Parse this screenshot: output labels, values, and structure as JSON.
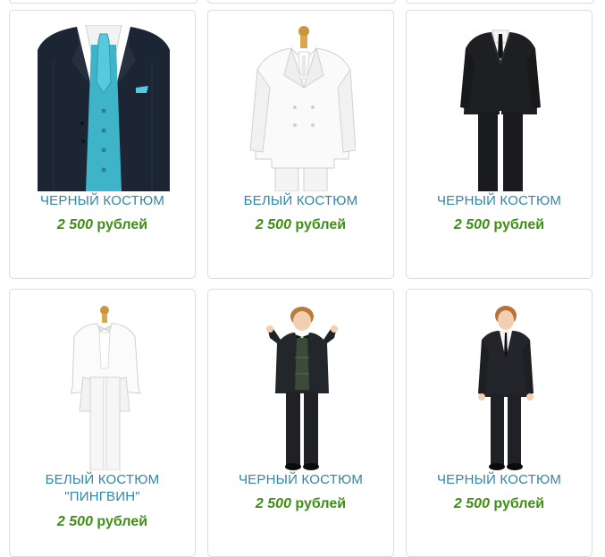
{
  "colors": {
    "title": "#2f86a8",
    "price": "#3f8f17",
    "card_border": "#dcdcdc"
  },
  "products": [
    {
      "title": "ЧЕРНЫЙ КОСТЮМ",
      "amount": "2 500",
      "currency": "рублей",
      "image": "navy-suit-turquoise-vest-image"
    },
    {
      "title": "БЕЛЫЙ КОСТЮМ",
      "amount": "2 500",
      "currency": "рублей",
      "image": "white-double-breasted-suit-image"
    },
    {
      "title": "ЧЕРНЫЙ КОСТЮМ",
      "amount": "2 500",
      "currency": "рублей",
      "image": "black-suit-on-hanger-image"
    },
    {
      "title_line1": "БЕЛЫЙ КОСТЮМ",
      "title_line2": "\"ПИНГВИН\"",
      "amount": "2 500",
      "currency": "рублей",
      "image": "white-tailcoat-image"
    },
    {
      "title": "ЧЕРНЫЙ КОСТЮМ",
      "amount": "2 500",
      "currency": "рублей",
      "image": "boy-in-tuxedo-thumbs-up-image"
    },
    {
      "title": "ЧЕРНЫЙ КОСТЮМ",
      "amount": "2 500",
      "currency": "рублей",
      "image": "boy-in-black-suit-image"
    }
  ]
}
